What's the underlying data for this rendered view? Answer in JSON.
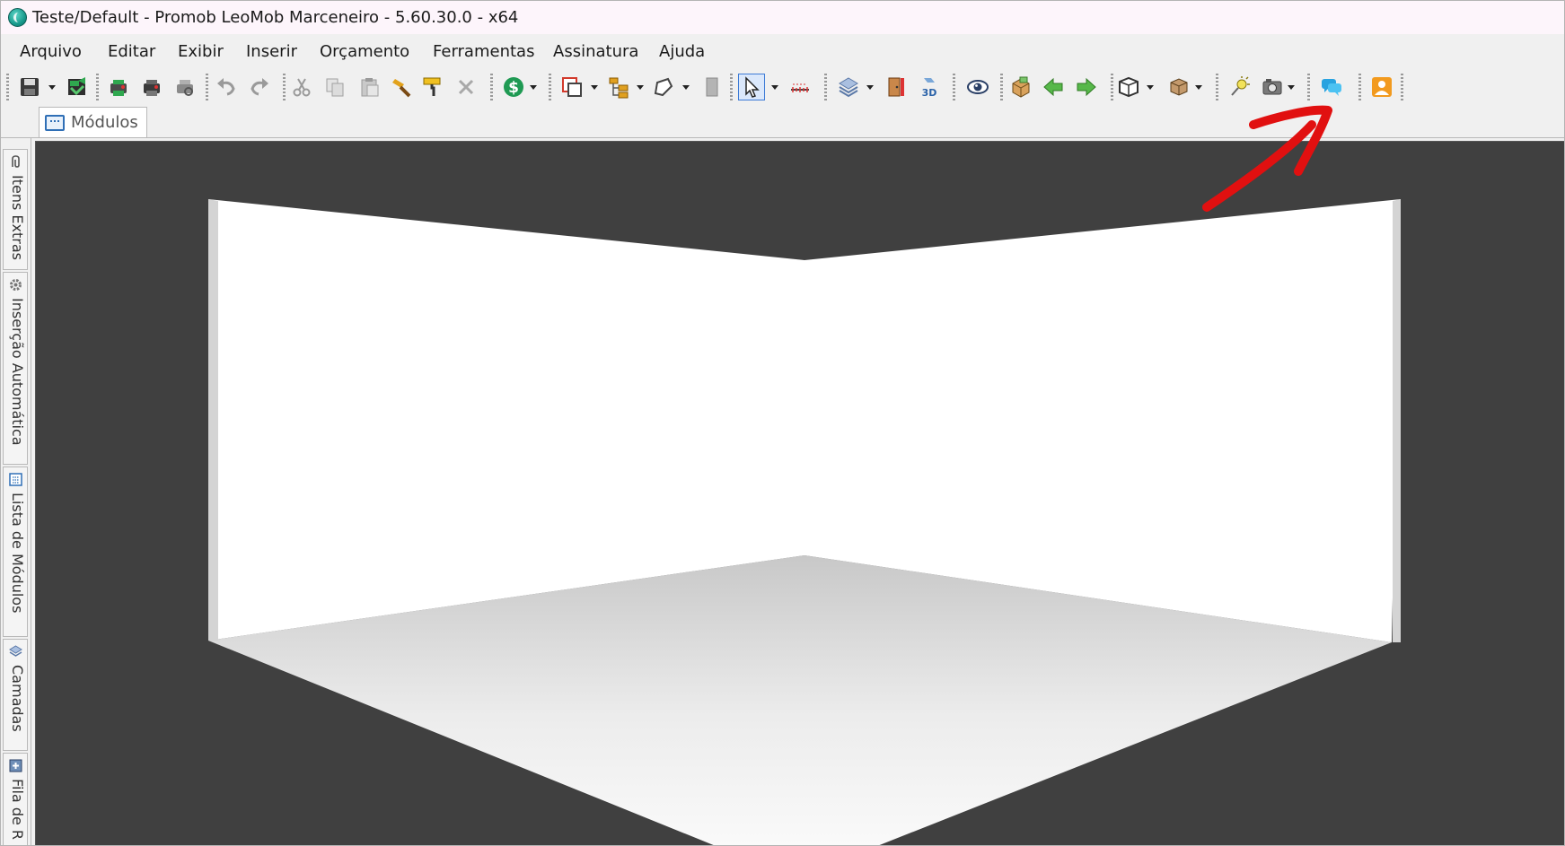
{
  "window": {
    "title": "Teste/Default - Promob LeoMob Marceneiro - 5.60.30.0 - x64"
  },
  "menu": {
    "items": [
      "Arquivo",
      "Editar",
      "Exibir",
      "Inserir",
      "Orçamento",
      "Ferramentas",
      "Assinatura",
      "Ajuda"
    ]
  },
  "toolbar": {
    "icons": [
      "save-icon",
      "open-project-icon",
      "render-icon",
      "print-icon",
      "print-preview-icon",
      "undo-icon",
      "redo-icon",
      "cut-icon",
      "copy-icon",
      "paste-icon",
      "hammer-icon",
      "paint-roller-icon",
      "delete-icon",
      "budget-dollar-icon",
      "insert-module-icon",
      "hierarchy-icon",
      "shape-icon",
      "panel-icon",
      "select-arrow-icon",
      "measure-icon",
      "layers-icon",
      "door-icon",
      "3d-view-icon",
      "eye-icon",
      "box-icon",
      "back-arrow-icon",
      "forward-arrow-icon",
      "room-view-icon",
      "package-icon",
      "light-icon",
      "camera-icon",
      "chat-support-icon",
      "user-account-icon"
    ],
    "highlighted": "chat-support-icon"
  },
  "tabs": {
    "modulos": "Módulos"
  },
  "side_panel": {
    "tabs": [
      "Itens Extras",
      "Inserção Automática",
      "Lista de Módulos",
      "Camadas",
      "Fila de R"
    ]
  },
  "viewport": {
    "background": "#404040",
    "wall_color": "#ffffff",
    "annotation_color": "#e11010"
  }
}
